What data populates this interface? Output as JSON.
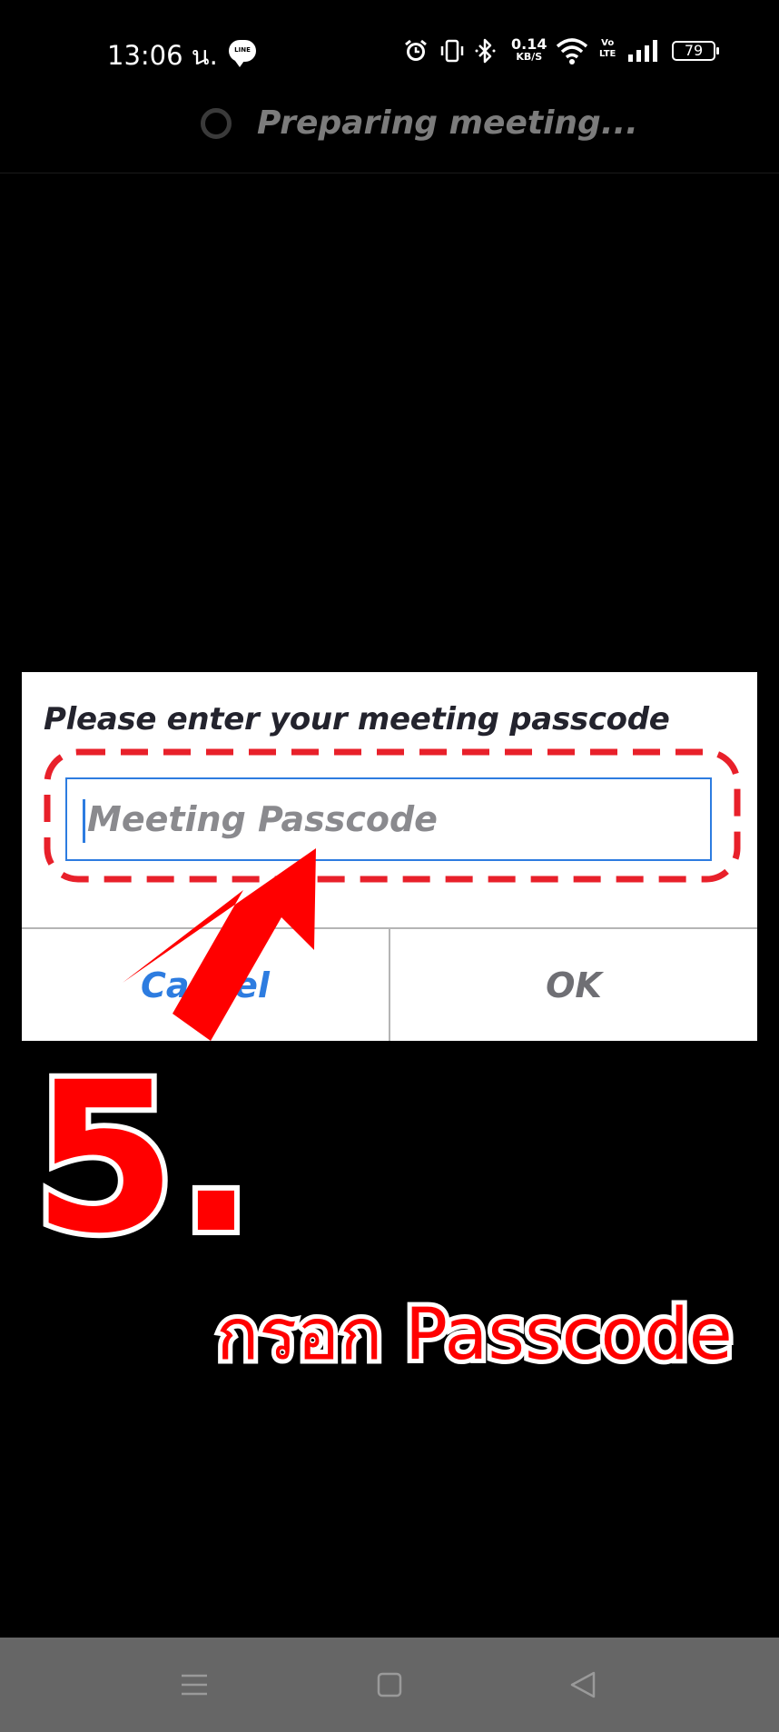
{
  "status_bar": {
    "time": "13:06 น.",
    "line_label": "LINE",
    "net_speed_value": "0.14",
    "net_speed_unit": "KB/S",
    "volte_top": "Vo",
    "volte_bottom": "LTE",
    "battery": "79",
    "icons": [
      "line-app-icon",
      "alarm-icon",
      "vibrate-icon",
      "bluetooth-icon",
      "wifi-icon",
      "signal-icon",
      "battery-icon"
    ]
  },
  "meeting": {
    "status_text": "Preparing meeting..."
  },
  "dialog": {
    "title": "Please enter your meeting passcode",
    "input_placeholder": "Meeting Passcode",
    "input_value": "",
    "cancel_label": "Cancel",
    "ok_label": "OK"
  },
  "annotation": {
    "step_number": "5.",
    "instruction": "กรอก Passcode",
    "accent_color": "#ff0000",
    "highlight_color": "#e8202a"
  },
  "nav_bar": {
    "buttons": [
      "menu-icon",
      "home-icon",
      "back-icon"
    ]
  }
}
